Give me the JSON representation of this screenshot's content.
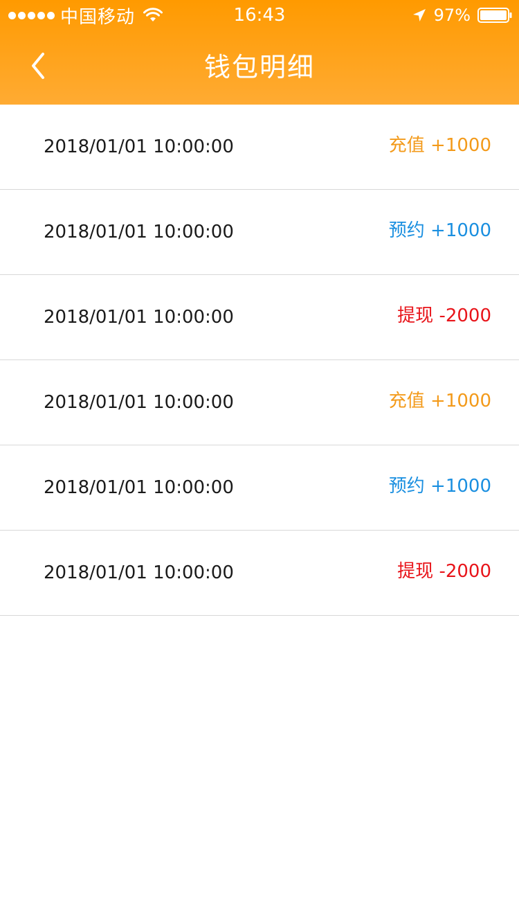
{
  "status_bar": {
    "carrier": "中国移动",
    "time": "16:43",
    "battery": "97%",
    "signal_icon": "signal-dots-icon",
    "wifi_icon": "wifi-icon",
    "location_icon": "location-arrow-icon",
    "battery_icon": "battery-icon"
  },
  "nav": {
    "title": "钱包明细",
    "back_icon": "chevron-left-icon"
  },
  "colors": {
    "header_top": "#ff9a00",
    "header_bottom": "#ffab33",
    "recharge": "#f39a1a",
    "reservation": "#1a8fe0",
    "withdraw": "#e8141a"
  },
  "records": [
    {
      "time": "2018/01/01 10:00:00",
      "type": "充值",
      "amount": "+1000",
      "kind": "recharge"
    },
    {
      "time": "2018/01/01 10:00:00",
      "type": "预约",
      "amount": "+1000",
      "kind": "reservation"
    },
    {
      "time": "2018/01/01 10:00:00",
      "type": "提现",
      "amount": "-2000",
      "kind": "withdraw"
    },
    {
      "time": "2018/01/01 10:00:00",
      "type": "充值",
      "amount": "+1000",
      "kind": "recharge"
    },
    {
      "time": "2018/01/01 10:00:00",
      "type": "预约",
      "amount": "+1000",
      "kind": "reservation"
    },
    {
      "time": "2018/01/01 10:00:00",
      "type": "提现",
      "amount": "-2000",
      "kind": "withdraw"
    }
  ]
}
